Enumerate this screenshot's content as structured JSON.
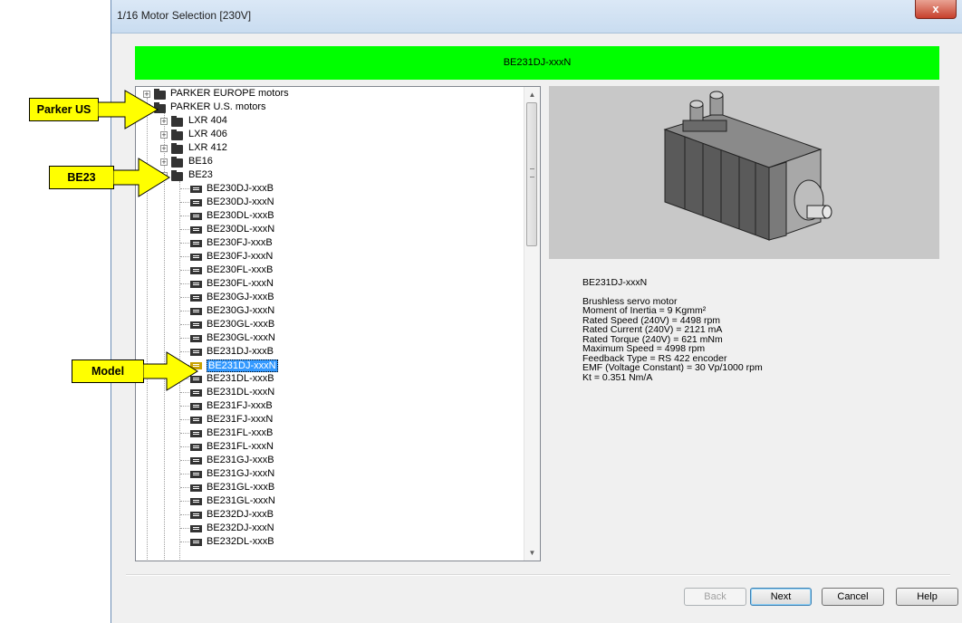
{
  "window": {
    "title": "1/16 Motor Selection [230V]",
    "close_glyph": "x"
  },
  "header_bar": {
    "text": "BE231DJ-xxxN",
    "color": "#00ff00"
  },
  "tree": {
    "root_nodes": [
      {
        "label": "PARKER EUROPE motors",
        "expanded": false
      },
      {
        "label": "PARKER U.S. motors",
        "expanded": true
      }
    ],
    "groups": [
      {
        "label": "LXR 404",
        "expanded": false
      },
      {
        "label": "LXR 406",
        "expanded": false
      },
      {
        "label": "LXR 412",
        "expanded": false
      },
      {
        "label": "BE16",
        "expanded": false
      },
      {
        "label": "BE23",
        "expanded": true
      }
    ],
    "models": [
      "BE230DJ-xxxB",
      "BE230DJ-xxxN",
      "BE230DL-xxxB",
      "BE230DL-xxxN",
      "BE230FJ-xxxB",
      "BE230FJ-xxxN",
      "BE230FL-xxxB",
      "BE230FL-xxxN",
      "BE230GJ-xxxB",
      "BE230GJ-xxxN",
      "BE230GL-xxxB",
      "BE230GL-xxxN",
      "BE231DJ-xxxB",
      "BE231DJ-xxxN",
      "BE231DL-xxxB",
      "BE231DL-xxxN",
      "BE231FJ-xxxB",
      "BE231FJ-xxxN",
      "BE231FL-xxxB",
      "BE231FL-xxxN",
      "BE231GJ-xxxB",
      "BE231GJ-xxxN",
      "BE231GL-xxxB",
      "BE231GL-xxxN",
      "BE232DJ-xxxB",
      "BE232DJ-xxxN",
      "BE232DL-xxxB"
    ],
    "selected_model": "BE231DJ-xxxN"
  },
  "details": {
    "model": "BE231DJ-xxxN",
    "type": "Brushless servo motor",
    "inertia": "Moment of Inertia  =  9 Kgmm²",
    "rated_speed": "Rated Speed (240V)  =  4498 rpm",
    "rated_current": "Rated Current (240V)  =  2121 mA",
    "rated_torque": "Rated Torque (240V)  =  621 mNm",
    "max_speed": "Maximum Speed  =  4998 rpm",
    "feedback": "Feedback Type = RS 422 encoder",
    "emf": "EMF (Voltage Constant)  =  30 Vp/1000 rpm",
    "kt": "Kt = 0.351 Nm/A"
  },
  "buttons": {
    "back": "Back",
    "next": "Next",
    "cancel": "Cancel",
    "help": "Help"
  },
  "callouts": {
    "parker_us": "Parker US",
    "be23": "BE23",
    "model": "Model"
  },
  "colors": {
    "callout_fill": "#ffff00",
    "selection": "#3399ff",
    "selected_icon": "#c9a200"
  }
}
